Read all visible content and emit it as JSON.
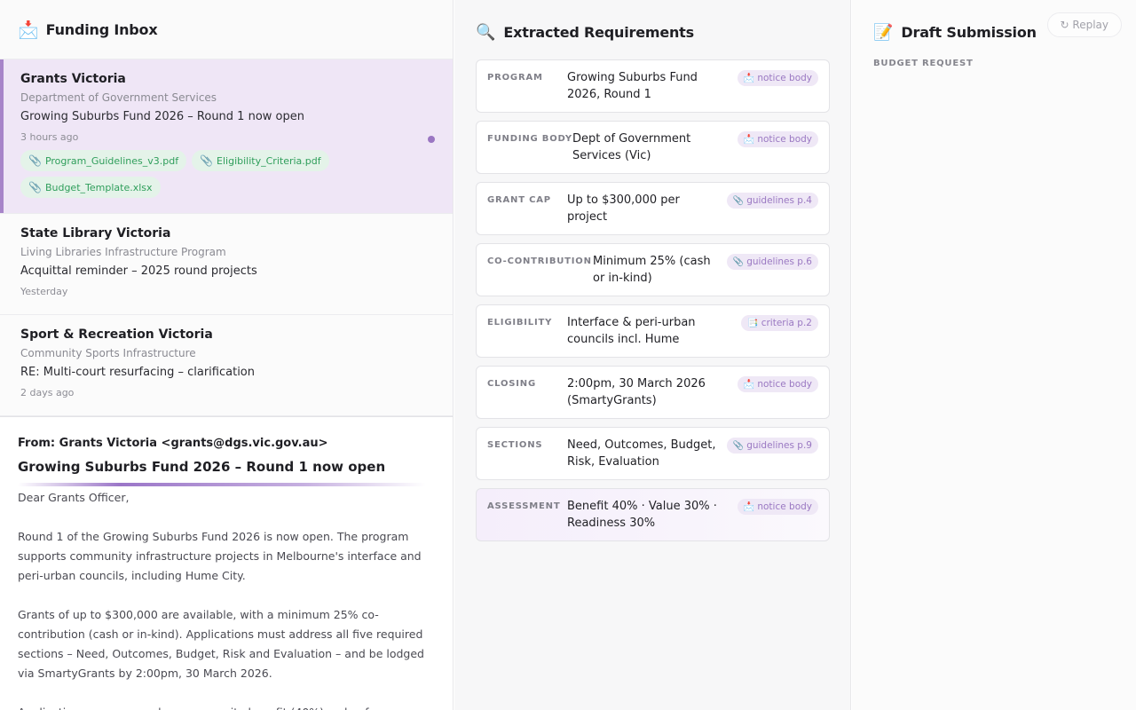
{
  "inbox": {
    "title": "Funding Inbox",
    "icon": "📩",
    "messages": [
      {
        "sender": "Grants Victoria",
        "org": "Department of Government Services",
        "subject": "Growing Suburbs Fund 2026 – Round 1 now open",
        "time": "3 hours ago",
        "unread": true,
        "attachments": [
          "Program_Guidelines_v3.pdf",
          "Eligibility_Criteria.pdf",
          "Budget_Template.xlsx"
        ]
      },
      {
        "sender": "State Library Victoria",
        "org": "Living Libraries Infrastructure Program",
        "subject": "Acquittal reminder – 2025 round projects",
        "time": "Yesterday"
      },
      {
        "sender": "Sport & Recreation Victoria",
        "org": "Community Sports Infrastructure",
        "subject": "RE: Multi-court resurfacing – clarification",
        "time": "2 days ago"
      }
    ]
  },
  "reader": {
    "from": "From: Grants Victoria <grants@dgs.vic.gov.au>",
    "subject": "Growing Suburbs Fund 2026 – Round 1 now open",
    "greeting": "Dear Grants Officer,",
    "para1": "Round 1 of the Growing Suburbs Fund 2026 is now open. The program supports community infrastructure projects in Melbourne's interface and peri-urban councils, including Hume City.",
    "para2": "Grants of up to $300,000 are available, with a minimum 25% co-contribution (cash or in-kind). Applications must address all five required sections – Need, Outcomes, Budget, Risk and Evaluation – and be lodged via SmartyGrants by 2:00pm, 30 March 2026.",
    "para3": "Applications are assessed on community benefit (40%), value for"
  },
  "requirements": {
    "title": "Extracted Requirements",
    "icon": "🔍",
    "items": [
      {
        "key": "PROGRAM",
        "value": "Growing Suburbs Fund 2026, Round 1",
        "source": "notice body",
        "source_icon": "📩"
      },
      {
        "key": "FUNDING BODY",
        "value": "Dept of Government Services (Vic)",
        "source": "notice body",
        "source_icon": "📩"
      },
      {
        "key": "GRANT CAP",
        "value": "Up to $300,000 per project",
        "source": "guidelines p.4",
        "source_icon": "📎"
      },
      {
        "key": "CO-CONTRIBUTION",
        "value": "Minimum 25% (cash or in-kind)",
        "source": "guidelines p.6",
        "source_icon": "📎"
      },
      {
        "key": "ELIGIBILITY",
        "value": "Interface & peri-urban councils incl. Hume",
        "source": "criteria p.2",
        "source_icon": "📑"
      },
      {
        "key": "CLOSING",
        "value": "2:00pm, 30 March 2026 (SmartyGrants)",
        "source": "notice body",
        "source_icon": "📩"
      },
      {
        "key": "SECTIONS",
        "value": "Need, Outcomes, Budget, Risk, Evaluation",
        "source": "guidelines p.9",
        "source_icon": "📎"
      },
      {
        "key": "ASSESSMENT",
        "value": "Benefit 40% · Value 30% · Readiness 30%",
        "source": "notice body",
        "source_icon": "📩"
      }
    ]
  },
  "draft": {
    "title": "Draft Submission",
    "icon": "📝",
    "replay_label": "↻ Replay",
    "section_label": "BUDGET REQUEST"
  },
  "colors": {
    "accent": "#9b76c8",
    "active_row": "#efe6f6",
    "attachment_green": "#2f9e5b"
  }
}
